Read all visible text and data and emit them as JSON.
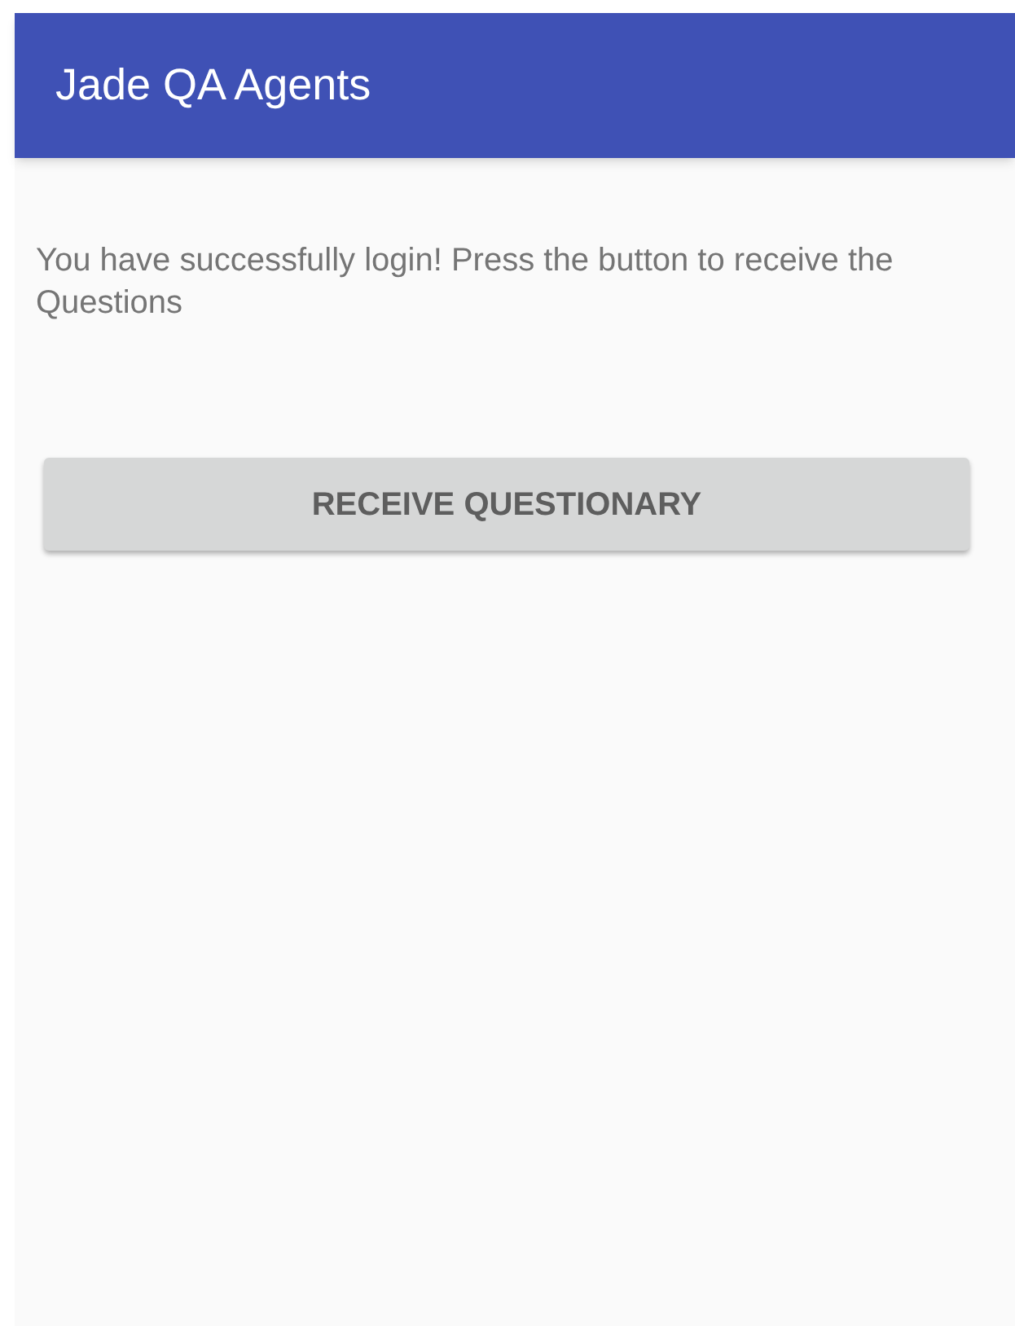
{
  "app_bar": {
    "title": "Jade QA Agents"
  },
  "message": "You have successfully login! Press the button to receive the Questions",
  "button": {
    "label": "RECEIVE QUESTIONARY"
  }
}
